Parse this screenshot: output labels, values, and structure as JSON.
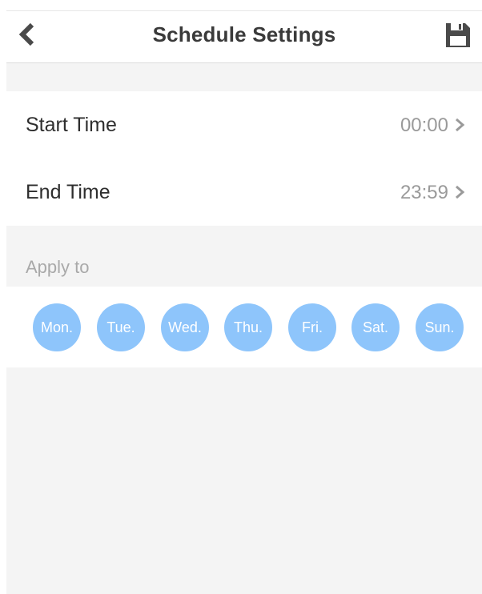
{
  "header": {
    "title": "Schedule Settings",
    "back_icon": "back-arrow-icon",
    "save_icon": "floppy-disk-save-icon"
  },
  "times": {
    "start_label": "Start Time",
    "start_value": "00:00",
    "end_label": "End Time",
    "end_value": "23:59",
    "chevron_icon": "chevron-right-icon"
  },
  "apply": {
    "label": "Apply to",
    "days": [
      "Mon.",
      "Tue.",
      "Wed.",
      "Thu.",
      "Fri.",
      "Sat.",
      "Sun."
    ]
  },
  "colors": {
    "day_circle": "#8ec5fb",
    "title_text": "#3a3a3a",
    "value_text": "#9a9a9a",
    "background": "#f4f4f4"
  }
}
